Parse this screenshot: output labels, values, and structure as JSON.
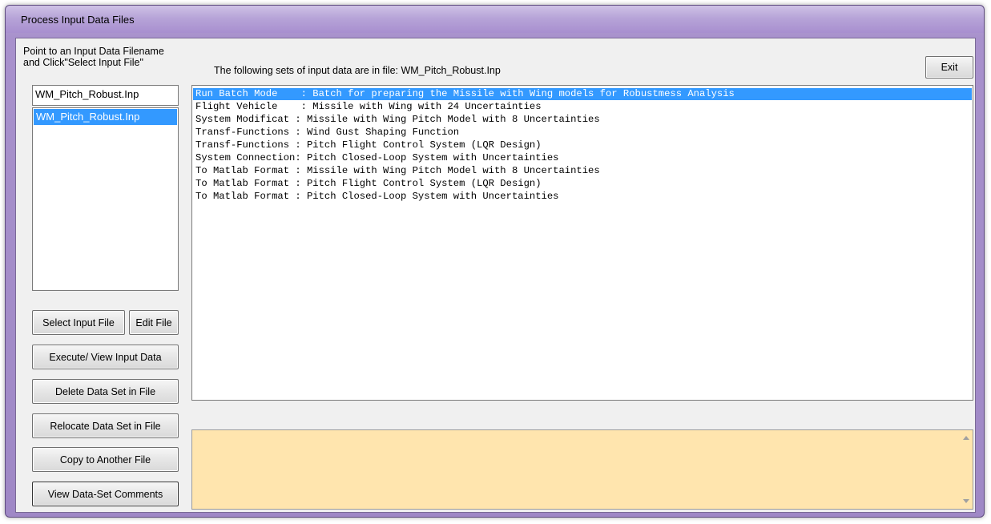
{
  "window": {
    "title": "Process Input Data Files"
  },
  "instructions": {
    "line1": "Point to an Input Data Filename",
    "line2": "and Click\"Select Input File\""
  },
  "header": {
    "text": "The following sets of input data are in file: WM_Pitch_Robust.Inp"
  },
  "buttons": {
    "exit": "Exit",
    "select_input_file": "Select Input File",
    "edit_file": "Edit File",
    "execute_view": "Execute/ View Input Data",
    "delete_data_set": "Delete Data Set in File",
    "relocate_data_set": "Relocate Data Set in File",
    "copy_to_another": "Copy to Another File",
    "view_comments": "View Data-Set Comments"
  },
  "filename_input": {
    "value": "WM_Pitch_Robust.Inp"
  },
  "file_list": {
    "items": [
      "WM_Pitch_Robust.Inp"
    ],
    "selected_index": 0
  },
  "data_sets": {
    "selected_index": 0,
    "rows": [
      "Run Batch Mode    : Batch for preparing the Missile with Wing models for Robustmess Analysis",
      "Flight Vehicle    : Missile with Wing with 24 Uncertainties",
      "System Modificat : Missile with Wing Pitch Model with 8 Uncertainties",
      "Transf-Functions : Wind Gust Shaping Function",
      "Transf-Functions : Pitch Flight Control System (LQR Design)",
      "System Connection: Pitch Closed-Loop System with Uncertainties",
      "To Matlab Format : Missile with Wing Pitch Model with 8 Uncertainties",
      "To Matlab Format : Pitch Flight Control System (LQR Design)",
      "To Matlab Format : Pitch Closed-Loop System with Uncertainties"
    ]
  },
  "comments": {
    "text": ""
  },
  "colors": {
    "selection": "#3399ff",
    "comments_bg": "#ffe5ae",
    "frame": "#a891cc"
  }
}
